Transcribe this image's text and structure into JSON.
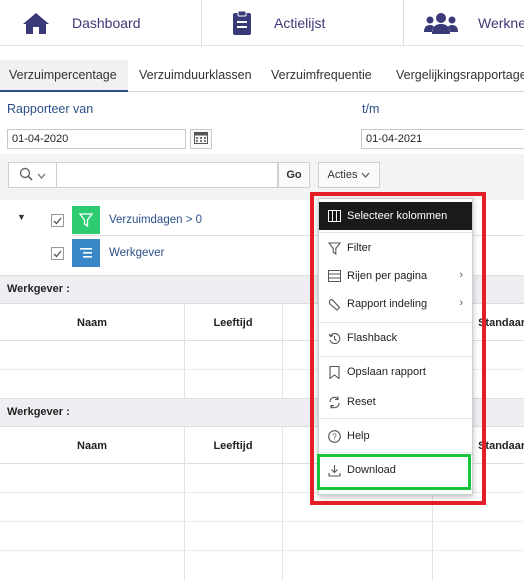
{
  "topnav": {
    "items": [
      {
        "label": "Dashboard",
        "icon": "home-icon"
      },
      {
        "label": "Actielijst",
        "icon": "clipboard-icon"
      },
      {
        "label": "Werkne",
        "icon": "users-icon"
      }
    ]
  },
  "tabs": [
    "Verzuimpercentage",
    "Verzuimduurklassen",
    "Verzuimfrequentie",
    "Vergelijkingsrapportage"
  ],
  "report": {
    "from_label": "Rapporteer van",
    "to_label": "t/m",
    "from_date": "01-04-2020",
    "to_date": "01-04-2021"
  },
  "toolbar": {
    "go_label": "Go",
    "actions_label": "Acties",
    "search_value": ""
  },
  "filters": [
    {
      "label": "Verzuimdagen > 0",
      "icon": "filter-icon",
      "color": "#2ecc71"
    },
    {
      "label": "Werkgever",
      "icon": "group-by-icon",
      "color": "#3a87c8"
    }
  ],
  "groups": [
    {
      "title": "Werkgever :",
      "columns": [
        "Naam",
        "Leeftijd",
        "Standaard"
      ]
    },
    {
      "title": "Werkgever :",
      "columns": [
        "Naam",
        "Leeftijd",
        "Standaard"
      ]
    }
  ],
  "menu": {
    "items": [
      {
        "label": "Selecteer kolommen",
        "icon": "columns-icon"
      },
      {
        "label": "Filter",
        "icon": "filter-icon"
      },
      {
        "label": "Rijen per pagina",
        "icon": "rows-icon",
        "submenu": true
      },
      {
        "label": "Rapport indeling",
        "icon": "wrench-icon",
        "submenu": true
      },
      {
        "label": "Flashback",
        "icon": "flashback-icon"
      },
      {
        "label": "Opslaan rapport",
        "icon": "bookmark-icon"
      },
      {
        "label": "Reset",
        "icon": "reset-icon"
      },
      {
        "label": "Help",
        "icon": "help-icon"
      },
      {
        "label": "Download",
        "icon": "download-icon"
      }
    ]
  },
  "colors": {
    "accent": "#2b4f8a",
    "nav_icon": "#3a3a78",
    "highlight_red": "#e41e26",
    "highlight_green": "#19c33a"
  }
}
